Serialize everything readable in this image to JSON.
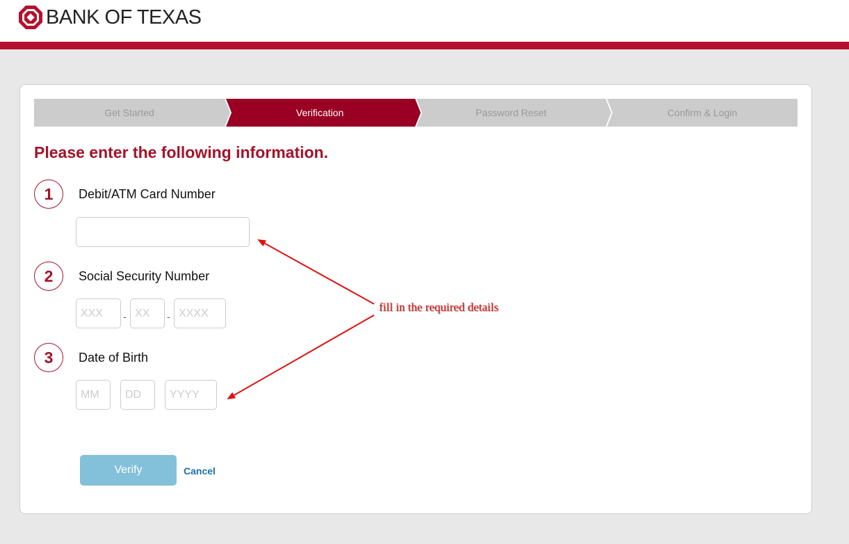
{
  "brand": {
    "name": "BANK OF TEXAS",
    "accent_color": "#b5112e",
    "logo_icon": "octagon-logo-icon"
  },
  "steps": [
    {
      "label": "Get Started",
      "active": false
    },
    {
      "label": "Verification",
      "active": true
    },
    {
      "label": "Password Reset",
      "active": false
    },
    {
      "label": "Confirm & Login",
      "active": false
    }
  ],
  "form": {
    "heading": "Please enter the following information.",
    "card": {
      "number": "1",
      "label": "Debit/ATM Card Number",
      "value": ""
    },
    "ssn": {
      "number": "2",
      "label": "Social Security Number",
      "part1_placeholder": "XXX",
      "part2_placeholder": "XX",
      "part3_placeholder": "XXXX",
      "separator": "-"
    },
    "dob": {
      "number": "3",
      "label": "Date of Birth",
      "month_placeholder": "MM",
      "day_placeholder": "DD",
      "year_placeholder": "YYYY"
    },
    "verify_label": "Verify",
    "cancel_label": "Cancel"
  },
  "annotation": {
    "text": "fill in the required details",
    "color": "#e01010"
  }
}
